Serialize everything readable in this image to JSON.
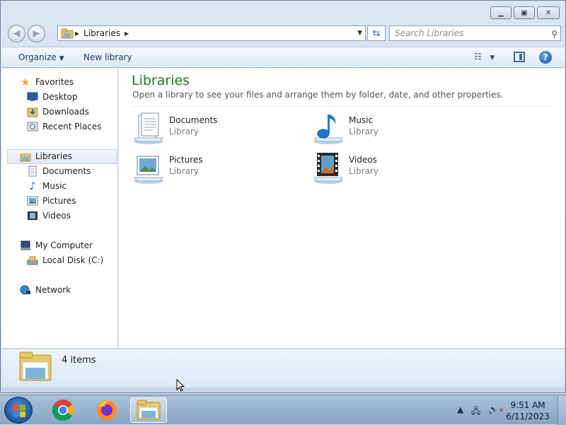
{
  "window": {
    "address": {
      "crumb": "Libraries"
    },
    "search": {
      "placeholder": "Search Libraries"
    },
    "toolbar": {
      "organize": "Organize",
      "new_library": "New library"
    },
    "nav": {
      "favorites": "Favorites",
      "desktop": "Desktop",
      "downloads": "Downloads",
      "recent_places": "Recent Places",
      "libraries": "Libraries",
      "documents": "Documents",
      "music": "Music",
      "pictures": "Pictures",
      "videos": "Videos",
      "my_computer": "My Computer",
      "local_disk": "Local Disk (C:)",
      "network": "Network"
    },
    "content": {
      "title": "Libraries",
      "subtitle": "Open a library to see your files and arrange them by folder, date, and other properties.",
      "libraries": [
        {
          "name": "Documents",
          "type": "Library",
          "icon": "documents-library-icon"
        },
        {
          "name": "Music",
          "type": "Library",
          "icon": "music-library-icon"
        },
        {
          "name": "Pictures",
          "type": "Library",
          "icon": "pictures-library-icon"
        },
        {
          "name": "Videos",
          "type": "Library",
          "icon": "videos-library-icon"
        }
      ]
    },
    "details": {
      "count": "4 items"
    }
  },
  "taskbar": {
    "apps": [
      "chrome-icon",
      "firefox-icon",
      "explorer-icon"
    ],
    "clock": {
      "time": "9:51 AM",
      "date": "6/11/2023"
    }
  },
  "colors": {
    "accent_title": "#1e7a1e",
    "taskbar": "#9cb4cf"
  }
}
